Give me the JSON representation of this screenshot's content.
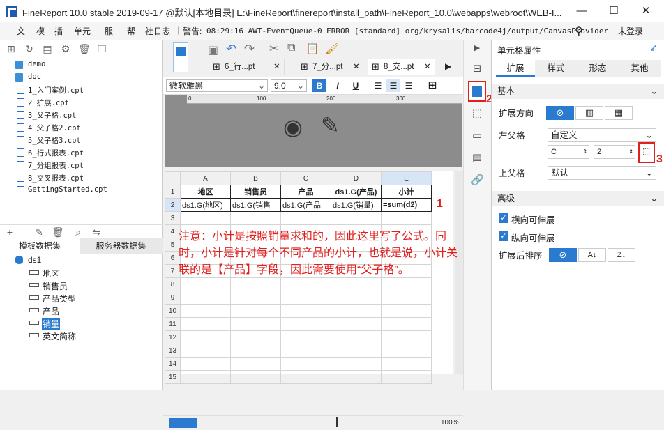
{
  "window": {
    "title": "FineReport 10.0 stable 2019-09-17 @默认[本地目录]   E:\\FineReport\\finereport\\install_path\\FineReport_10.0\\webapps\\webroot\\WEB-I...",
    "minimize": "—",
    "maximize": "☐",
    "close": "✕"
  },
  "menu": {
    "items": [
      "文",
      "模",
      "插",
      "单元",
      "服",
      "帮",
      "社"
    ],
    "log_label": "日志",
    "warning_label": "警告:",
    "warning_text": "08:29:16 AWT-EventQueue-0 ERROR [standard] org/krysalis/barcode4j/output/CanvasProvider",
    "login": "未登录"
  },
  "tree": [
    {
      "label": "demo",
      "type": "folder"
    },
    {
      "label": "doc",
      "type": "folder"
    },
    {
      "label": "1_入门案例.cpt",
      "type": "file"
    },
    {
      "label": "2_扩展.cpt",
      "type": "file"
    },
    {
      "label": "3_父子格.cpt",
      "type": "file"
    },
    {
      "label": "4_父子格2.cpt",
      "type": "file"
    },
    {
      "label": "5_父子格3.cpt",
      "type": "file"
    },
    {
      "label": "6_行式报表.cpt",
      "type": "file"
    },
    {
      "label": "7_分组报表.cpt",
      "type": "file"
    },
    {
      "label": "8_交叉报表.cpt",
      "type": "file"
    },
    {
      "label": "GettingStarted.cpt",
      "type": "file"
    }
  ],
  "dataset_tabs": [
    "模板数据集",
    "服务器数据集"
  ],
  "dataset": {
    "name": "ds1",
    "fields": [
      "地区",
      "销售员",
      "产品类型",
      "产品",
      "销量",
      "英文简称"
    ],
    "selected": "销量"
  },
  "doc_tabs": [
    "6_行...pt",
    "7_分...pt",
    "8_交...pt"
  ],
  "format": {
    "font": "微软雅黑",
    "size": "9.0",
    "bold": "B",
    "italic": "I",
    "underline": "U"
  },
  "ruler": [
    "0",
    "100",
    "200",
    "300"
  ],
  "sheet": {
    "columns": [
      "A",
      "B",
      "C",
      "D",
      "E"
    ],
    "rows": [
      "1",
      "2",
      "3",
      "4",
      "5",
      "6",
      "7",
      "8",
      "9",
      "10",
      "11",
      "12",
      "13",
      "14",
      "15"
    ],
    "row1": [
      "地区",
      "销售员",
      "产品",
      "ds1.G(产品)",
      "小计"
    ],
    "row2": [
      "ds1.G(地区)",
      "ds1.G(销售",
      "ds1.G(产品",
      "ds1.G(销量)",
      "=sum(d2)"
    ]
  },
  "note": "注意：小计是按照销量求和的，因此这里写了公式。同时，小计是针对每个不同产品的小计，也就是说，小计关联的是【产品】字段，因此需要使用“父子格”。",
  "markers": {
    "one": "1",
    "two": "2",
    "three": "3"
  },
  "props": {
    "title": "单元格属性",
    "tabs": [
      "扩展",
      "样式",
      "形态",
      "其他"
    ],
    "basic": "基本",
    "expand_dir": "扩展方向",
    "left_parent": "左父格",
    "left_parent_value": "自定义",
    "col_value": "C",
    "row_value": "2",
    "up_parent": "上父格",
    "up_parent_value": "默认",
    "advanced": "高级",
    "h_expand": "横向可伸展",
    "v_expand": "纵向可伸展",
    "sort_after": "扩展后排序"
  },
  "status": {
    "zoom": "100%"
  }
}
